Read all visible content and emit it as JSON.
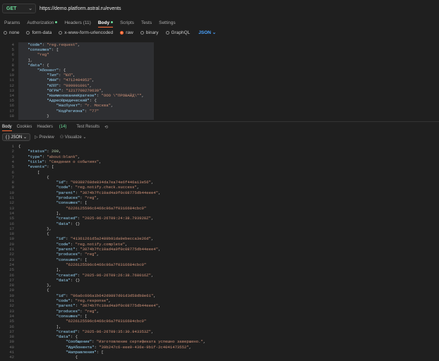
{
  "request": {
    "method": "GET",
    "url": "https://demo.platform.astral.ru/events"
  },
  "req_tabs": [
    {
      "label": "Params"
    },
    {
      "label": "Authorization"
    },
    {
      "label": "Headers (11)"
    },
    {
      "label": "Body"
    },
    {
      "label": "Scripts"
    },
    {
      "label": "Tests"
    },
    {
      "label": "Settings"
    }
  ],
  "body_options": [
    "none",
    "form-data",
    "x-www-form-urlencoded",
    "raw",
    "binary",
    "GraphQL"
  ],
  "body_format": "JSON",
  "request_lines": [
    {
      "n": "4",
      "t": "    \"code\": \"reg.request\","
    },
    {
      "n": "5",
      "t": "    \"consumes\": ["
    },
    {
      "n": "6",
      "t": "        \"reg\""
    },
    {
      "n": "7",
      "t": "    ],"
    },
    {
      "n": "8",
      "t": "    \"data\": {"
    },
    {
      "n": "9",
      "t": "        \"Абонент\": {"
    },
    {
      "n": "10",
      "t": "            \"Тип\": \"ЮЛ\","
    },
    {
      "n": "11",
      "t": "            \"ИНН\": \"4712404052\","
    },
    {
      "n": "12",
      "t": "            \"КПП\": \"999901001\","
    },
    {
      "n": "13",
      "t": "            \"ОГРН\": \"1217700270639\","
    },
    {
      "n": "14",
      "t": "            \"НаименованиеКраткое\": \"ООО \\\"ПРОВАЙД\\\"\","
    },
    {
      "n": "15",
      "t": "            \"АдресЮридический\": {"
    },
    {
      "n": "16",
      "t": "                \"НасПункт\": \"г. Москва\","
    },
    {
      "n": "17",
      "t": "                \"КодРегиона\": \"77\""
    },
    {
      "n": "18",
      "t": "            }"
    }
  ],
  "resp_tabs": [
    {
      "label": "Body"
    },
    {
      "label": "Cookies"
    },
    {
      "label": "Headers",
      "count": "(14)"
    },
    {
      "label": "Test Results"
    }
  ],
  "resp_tools": {
    "format": "{ } JSON",
    "preview": "Preview",
    "visualize": "Visualize"
  },
  "response_lines": [
    {
      "n": "1",
      "t": "{"
    },
    {
      "n": "2",
      "t": "    \"status\": 200,"
    },
    {
      "n": "3",
      "t": "    \"type\": \"about:blank\","
    },
    {
      "n": "4",
      "t": "    \"title\": \"Сведения о событиях\","
    },
    {
      "n": "5",
      "t": "    \"events\": ["
    },
    {
      "n": "6",
      "t": "        ["
    },
    {
      "n": "7",
      "t": "            {"
    },
    {
      "n": "8",
      "t": "                \"id\": \"09388768de834da7ea74e6f446a13e56\","
    },
    {
      "n": "9",
      "t": "                \"code\": \"reg.notify.check.success\","
    },
    {
      "n": "10",
      "t": "                \"parent\": \"3074b7fc10ad4a9f0c08775db44eee4\","
    },
    {
      "n": "11",
      "t": "                \"produces\": \"reg\","
    },
    {
      "n": "12",
      "t": "                \"consumes\": ["
    },
    {
      "n": "13",
      "t": "                    \"6226125596c6466c96a7f0316684cbc0\""
    },
    {
      "n": "14",
      "t": "                ],"
    },
    {
      "n": "15",
      "t": "                \"created\": \"2025-06-26T09:24:38.793928Z\","
    },
    {
      "n": "16",
      "t": "                \"data\": {}"
    },
    {
      "n": "17",
      "t": "            },"
    },
    {
      "n": "18",
      "t": "            {"
    },
    {
      "n": "19",
      "t": "                \"id\": \"41361261d5a2489b91da9ebecca3e26d\","
    },
    {
      "n": "20",
      "t": "                \"code\": \"reg.notify.complete\","
    },
    {
      "n": "21",
      "t": "                \"parent\": \"3074b7fc10ad4a9f0c08775db44eee4\","
    },
    {
      "n": "22",
      "t": "                \"produces\": \"reg\","
    },
    {
      "n": "23",
      "t": "                \"consumes\": ["
    },
    {
      "n": "24",
      "t": "                    \"6226125596c6466c96a7f0316684cbc0\""
    },
    {
      "n": "25",
      "t": "                ],"
    },
    {
      "n": "26",
      "t": "                \"created\": \"2025-06-26T09:26:38.768016Z\","
    },
    {
      "n": "27",
      "t": "                \"data\": {}"
    },
    {
      "n": "28",
      "t": "            },"
    },
    {
      "n": "29",
      "t": "            {"
    },
    {
      "n": "30",
      "t": "                \"id\": \"96a6c606a1b642d0897d01d3d58db8e61\","
    },
    {
      "n": "31",
      "t": "                \"code\": \"reg.response\","
    },
    {
      "n": "32",
      "t": "                \"parent\": \"3074b7fc10ad4a9f0c08775db44eee4\","
    },
    {
      "n": "33",
      "t": "                \"produces\": \"reg\","
    },
    {
      "n": "34",
      "t": "                \"consumes\": ["
    },
    {
      "n": "35",
      "t": "                    \"6226125596c6466c96a7f0316684cbc0\""
    },
    {
      "n": "36",
      "t": "                ],"
    },
    {
      "n": "37",
      "t": "                \"created\": \"2025-06-26T09:35:30.943353Z\","
    },
    {
      "n": "38",
      "t": "                \"data\": {"
    },
    {
      "n": "39",
      "t": "                    \"Сообщение\": \"Изготовление сертификата успешно завершено.\","
    },
    {
      "n": "40",
      "t": "                    \"ИдАбонента\": \"39b247c6-eee9-436e-9b1f-2c4041473552\","
    },
    {
      "n": "41",
      "t": "                    \"Направления\": ["
    },
    {
      "n": "42",
      "t": "                        {"
    }
  ]
}
